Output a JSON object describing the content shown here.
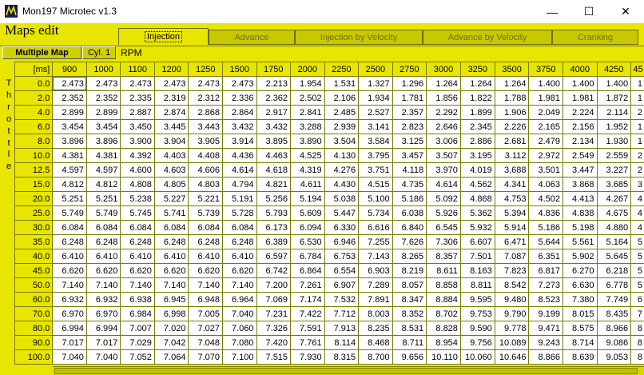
{
  "window": {
    "title": "Mon197 Microtec v1.3",
    "minimize_glyph": "—",
    "maximize_glyph": "☐",
    "close_glyph": "✕"
  },
  "header": {
    "title": "Maps edit"
  },
  "tabs": [
    {
      "label": "Injection",
      "active": true
    },
    {
      "label": "Advance"
    },
    {
      "label": "Injection by Velocity"
    },
    {
      "label": "Advance by Velocity"
    },
    {
      "label": "Cranking"
    }
  ],
  "controls": {
    "multiple_map": "Multiple Map",
    "cyl": "Cyl. 1",
    "rpm": "RPM"
  },
  "axis": {
    "corner": "[ms]",
    "row_title": "Throttle"
  },
  "table": {
    "columns": [
      "900",
      "1000",
      "1100",
      "1200",
      "1250",
      "1500",
      "1750",
      "2000",
      "2250",
      "2500",
      "2750",
      "3000",
      "3250",
      "3500",
      "3750",
      "4000",
      "4250",
      "45"
    ],
    "rows": [
      {
        "label": "0.0",
        "values": [
          "2.473",
          "2.473",
          "2.473",
          "2.473",
          "2.473",
          "2.473",
          "2.213",
          "1.954",
          "1.531",
          "1.327",
          "1.296",
          "1.264",
          "1.264",
          "1.264",
          "1.400",
          "1.400",
          "1.400",
          "1"
        ]
      },
      {
        "label": "2.0",
        "values": [
          "2.352",
          "2.352",
          "2.335",
          "2.319",
          "2.312",
          "2.336",
          "2.362",
          "2.502",
          "2.106",
          "1.934",
          "1.781",
          "1.856",
          "1.822",
          "1.788",
          "1.981",
          "1.981",
          "1.872",
          "1"
        ]
      },
      {
        "label": "4.0",
        "values": [
          "2.899",
          "2.899",
          "2.887",
          "2.874",
          "2.868",
          "2.864",
          "2.917",
          "2.841",
          "2.485",
          "2.527",
          "2.357",
          "2.292",
          "1.899",
          "1.906",
          "2.049",
          "2.224",
          "2.114",
          "2"
        ]
      },
      {
        "label": "6.0",
        "values": [
          "3.454",
          "3.454",
          "3.450",
          "3.445",
          "3.443",
          "3.432",
          "3.432",
          "3.288",
          "2.939",
          "3.141",
          "2.823",
          "2.646",
          "2.345",
          "2.226",
          "2.165",
          "2.156",
          "1.952",
          "1"
        ]
      },
      {
        "label": "8.0",
        "values": [
          "3.896",
          "3.896",
          "3.900",
          "3.904",
          "3.905",
          "3.914",
          "3.895",
          "3.890",
          "3.504",
          "3.584",
          "3.125",
          "3.006",
          "2.886",
          "2.681",
          "2.479",
          "2.134",
          "1.930",
          "1"
        ]
      },
      {
        "label": "10.0",
        "values": [
          "4.381",
          "4.381",
          "4.392",
          "4.403",
          "4.408",
          "4.436",
          "4.463",
          "4.525",
          "4.130",
          "3.795",
          "3.457",
          "3.507",
          "3.195",
          "3.112",
          "2.972",
          "2.549",
          "2.559",
          "2"
        ]
      },
      {
        "label": "12.5",
        "values": [
          "4.597",
          "4.597",
          "4.600",
          "4.603",
          "4.606",
          "4.614",
          "4.618",
          "4.319",
          "4.276",
          "3.751",
          "4.118",
          "3.970",
          "4.019",
          "3.688",
          "3.501",
          "3.447",
          "3.227",
          "2"
        ]
      },
      {
        "label": "15.0",
        "values": [
          "4.812",
          "4.812",
          "4.808",
          "4.805",
          "4.803",
          "4.794",
          "4.821",
          "4.611",
          "4.430",
          "4.515",
          "4.735",
          "4.614",
          "4.562",
          "4.341",
          "4.063",
          "3.868",
          "3.685",
          "3"
        ]
      },
      {
        "label": "20.0",
        "values": [
          "5.251",
          "5.251",
          "5.238",
          "5.227",
          "5.221",
          "5.191",
          "5.256",
          "5.194",
          "5.038",
          "5.100",
          "5.186",
          "5.092",
          "4.868",
          "4.753",
          "4.502",
          "4.413",
          "4.267",
          "4"
        ]
      },
      {
        "label": "25.0",
        "values": [
          "5.749",
          "5.749",
          "5.745",
          "5.741",
          "5.739",
          "5.728",
          "5.793",
          "5.609",
          "5.447",
          "5.734",
          "6.038",
          "5.926",
          "5.362",
          "5.394",
          "4.836",
          "4.838",
          "4.675",
          "4"
        ]
      },
      {
        "label": "30.0",
        "values": [
          "6.084",
          "6.084",
          "6.084",
          "6.084",
          "6.084",
          "6.084",
          "6.173",
          "6.094",
          "6.330",
          "6.616",
          "6.840",
          "6.545",
          "5.932",
          "5.914",
          "5.186",
          "5.198",
          "4.880",
          "4"
        ]
      },
      {
        "label": "35.0",
        "values": [
          "6.248",
          "6.248",
          "6.248",
          "6.248",
          "6.248",
          "6.248",
          "6.389",
          "6.530",
          "6.946",
          "7.255",
          "7.626",
          "7.306",
          "6.607",
          "6.471",
          "5.644",
          "5.561",
          "5.164",
          "5"
        ]
      },
      {
        "label": "40.0",
        "values": [
          "6.410",
          "6.410",
          "6.410",
          "6.410",
          "6.410",
          "6.410",
          "6.597",
          "6.784",
          "6.753",
          "7.143",
          "8.265",
          "8.357",
          "7.501",
          "7.087",
          "6.351",
          "5.902",
          "5.645",
          "5"
        ]
      },
      {
        "label": "45.0",
        "values": [
          "6.620",
          "6.620",
          "6.620",
          "6.620",
          "6.620",
          "6.620",
          "6.742",
          "6.864",
          "6.554",
          "6.903",
          "8.219",
          "8.611",
          "8.163",
          "7.823",
          "6.817",
          "6.270",
          "6.218",
          "5"
        ]
      },
      {
        "label": "50.0",
        "values": [
          "7.140",
          "7.140",
          "7.140",
          "7.140",
          "7.140",
          "7.140",
          "7.200",
          "7.261",
          "6.907",
          "7.289",
          "8.057",
          "8.858",
          "8.811",
          "8.542",
          "7.273",
          "6.630",
          "6.778",
          "5"
        ]
      },
      {
        "label": "60.0",
        "values": [
          "6.932",
          "6.932",
          "6.938",
          "6.945",
          "6.948",
          "6.964",
          "7.069",
          "7.174",
          "7.532",
          "7.891",
          "8.347",
          "8.884",
          "9.595",
          "9.480",
          "8.523",
          "7.380",
          "7.749",
          "6"
        ]
      },
      {
        "label": "70.0",
        "values": [
          "6.970",
          "6.970",
          "6.984",
          "6.998",
          "7.005",
          "7.040",
          "7.231",
          "7.422",
          "7.712",
          "8.003",
          "8.352",
          "8.702",
          "9.753",
          "9.790",
          "9.199",
          "8.015",
          "8.435",
          "7"
        ]
      },
      {
        "label": "80.0",
        "values": [
          "6.994",
          "6.994",
          "7.007",
          "7.020",
          "7.027",
          "7.060",
          "7.326",
          "7.591",
          "7.913",
          "8.235",
          "8.531",
          "8.828",
          "9.590",
          "9.778",
          "9.471",
          "8.575",
          "8.966",
          "8"
        ]
      },
      {
        "label": "90.0",
        "values": [
          "7.017",
          "7.017",
          "7.029",
          "7.042",
          "7.048",
          "7.080",
          "7.420",
          "7.761",
          "8.114",
          "8.468",
          "8.711",
          "8.954",
          "9.756",
          "10.089",
          "9.243",
          "8.714",
          "9.086",
          "8"
        ]
      },
      {
        "label": "100.0",
        "values": [
          "7.040",
          "7.040",
          "7.052",
          "7.064",
          "7.070",
          "7.100",
          "7.515",
          "7.930",
          "8.315",
          "8.700",
          "9.656",
          "10.110",
          "10.060",
          "10.646",
          "8.866",
          "8.639",
          "9.053",
          "8"
        ]
      }
    ]
  }
}
